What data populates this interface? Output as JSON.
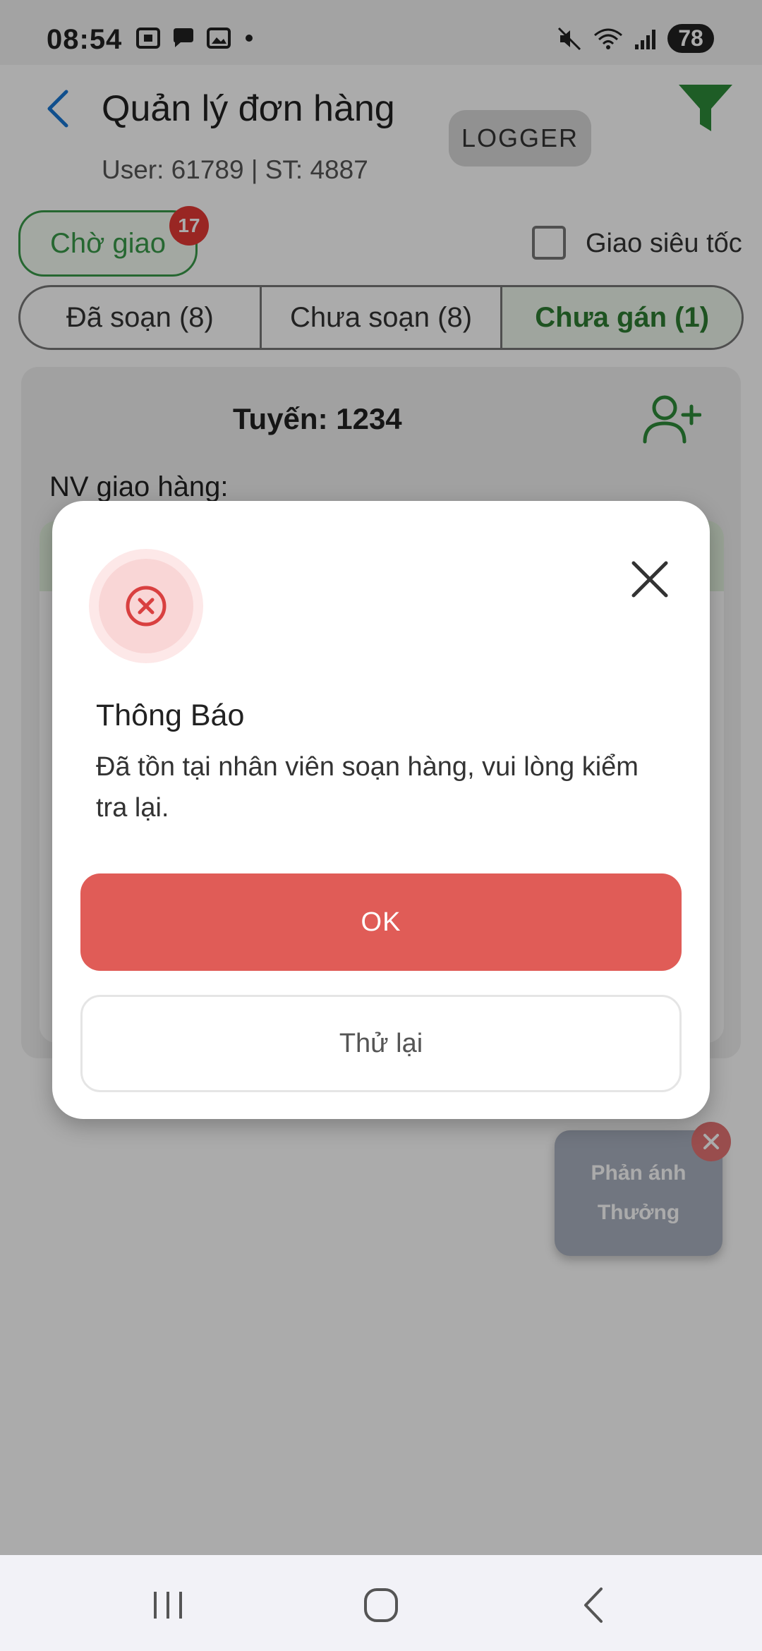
{
  "status_bar": {
    "time": "08:54",
    "battery": "78",
    "icons_left": [
      "screenshot-icon",
      "chat-icon",
      "gallery-icon",
      "notification-dot-icon"
    ],
    "icons_right": [
      "mute-icon",
      "wifi-icon",
      "signal-icon"
    ]
  },
  "header": {
    "title": "Quản lý đơn hàng",
    "user_info": "User: 61789 | ST: 4887",
    "logger_label": "LOGGER"
  },
  "status_chip": {
    "label": "Chờ giao",
    "badge": "17"
  },
  "express": {
    "label": "Giao siêu tốc",
    "checked": false
  },
  "tabs": [
    {
      "label": "Đã soạn (8)"
    },
    {
      "label": "Chưa soạn (8)"
    },
    {
      "label": "Chưa gán (1)"
    }
  ],
  "active_tab": 2,
  "route": {
    "title": "Tuyến: 1234",
    "shipper_label": "NV giao hàng:"
  },
  "reward_widget": {
    "line1": "Phản ánh",
    "line2": "Thưởng"
  },
  "dialog": {
    "title": "Thông Báo",
    "message": "Đã tồn tại nhân viên soạn hàng, vui lòng kiểm tra lại.",
    "ok_label": "OK",
    "retry_label": "Thử lại"
  },
  "colors": {
    "primary_green": "#2e7d32",
    "chip_green": "#3a9a4a",
    "danger": "#e05c57",
    "badge_red": "#e53935"
  }
}
